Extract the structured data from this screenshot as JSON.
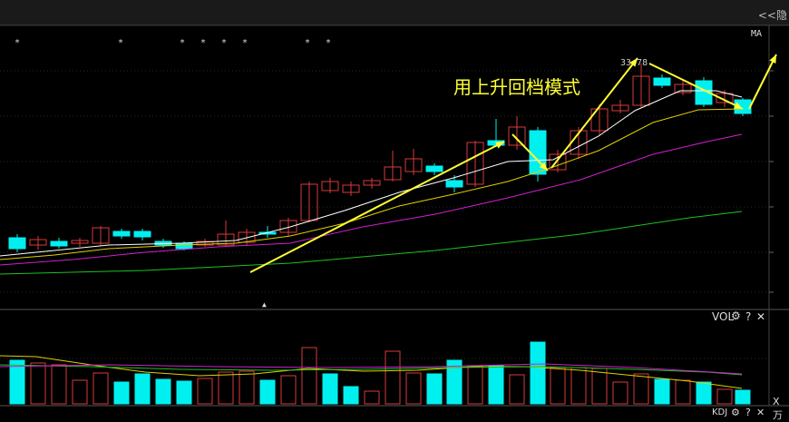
{
  "toolbar": {
    "nav_label": "<<隐"
  },
  "main_panel": {
    "indicator_label": "MA",
    "annotation": "用上升回档模式",
    "price_label": "33.78",
    "markers": [
      "*",
      "*",
      "*",
      "*",
      "*",
      "*",
      "*",
      "*"
    ],
    "cursor_marker": "▲"
  },
  "vol_panel": {
    "label": "VOL",
    "settings_icon": "⚙",
    "help_icon": "?",
    "close_icon": "✕",
    "unit_label": "X万"
  },
  "kdj_panel": {
    "label": "KDJ",
    "settings_icon": "⚙",
    "help_icon": "?",
    "close_icon": "✕"
  },
  "colors": {
    "up": "#d83a3a",
    "down": "#00f0f0",
    "ma5": "#ffffff",
    "ma10": "#e0d000",
    "ma20": "#d020d0",
    "ma60": "#20c020",
    "arrow": "#ffff33"
  }
}
